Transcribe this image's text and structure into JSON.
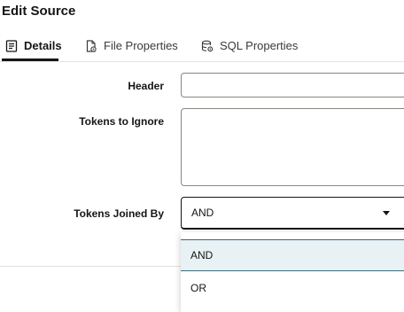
{
  "dialog": {
    "title": "Edit Source"
  },
  "tabs": [
    {
      "label": "Details",
      "icon": "document-list-icon",
      "active": true
    },
    {
      "label": "File Properties",
      "icon": "file-settings-icon",
      "active": false
    },
    {
      "label": "SQL Properties",
      "icon": "database-settings-icon",
      "active": false
    }
  ],
  "form": {
    "header": {
      "label": "Header",
      "value": ""
    },
    "tokens_to_ignore": {
      "label": "Tokens to Ignore",
      "value": ""
    },
    "tokens_joined_by": {
      "label": "Tokens Joined By",
      "value": "AND",
      "options": [
        "AND",
        "OR"
      ],
      "highlighted": "AND"
    }
  },
  "colors": {
    "accent_border": "#3a6a79",
    "highlight_bg": "#e8f1f3",
    "text": "#161513"
  }
}
